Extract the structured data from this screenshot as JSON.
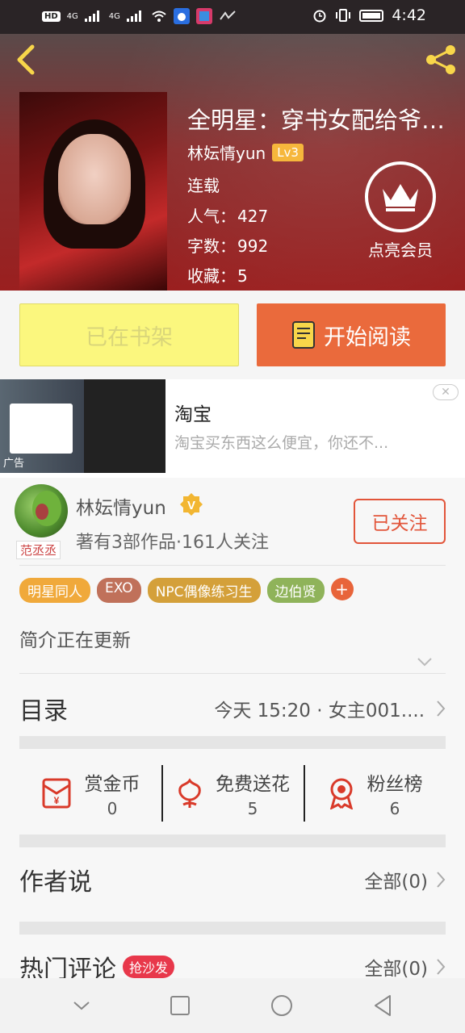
{
  "status_bar": {
    "hd": "HD",
    "net1": "4G",
    "net2": "4G",
    "time": "4:42"
  },
  "book": {
    "title": "全明星：穿书女配给爷…",
    "author": "林妘情yun",
    "level": "Lv3",
    "status": "连载",
    "popularity_label": "人气：",
    "popularity": "427",
    "words_label": "字数：",
    "words": "992",
    "favorites_label": "收藏：",
    "favorites": "5",
    "vip_label": "点亮会员"
  },
  "buttons": {
    "on_shelf": "已在书架",
    "start_reading": "开始阅读"
  },
  "ad": {
    "title": "淘宝",
    "description": "淘宝买东西这么便宜，你还不...",
    "tag": "广告",
    "close": "✕"
  },
  "author_card": {
    "name": "林妘情yun",
    "avatar_tag": "范丞丞",
    "stats": "著有3部作品·161人关注",
    "follow": "已关注"
  },
  "tags": [
    {
      "label": "明星同人",
      "color": "#f0a93b"
    },
    {
      "label": "EXO",
      "color": "#c0715a"
    },
    {
      "label": "NPC偶像练习生",
      "color": "#d4a03a"
    },
    {
      "label": "边伯贤",
      "color": "#8fb35a"
    }
  ],
  "intro": "简介正在更新",
  "toc": {
    "label": "目录",
    "latest": "今天 15:20 · 女主001...."
  },
  "stats": [
    {
      "label": "赏金币",
      "value": "0",
      "icon": "coin-envelope-icon"
    },
    {
      "label": "免费送花",
      "value": "5",
      "icon": "flower-icon"
    },
    {
      "label": "粉丝榜",
      "value": "6",
      "icon": "medal-icon"
    }
  ],
  "author_says": {
    "label": "作者说",
    "all": "全部(0)"
  },
  "hot_comments": {
    "label": "热门评论",
    "badge": "抢沙发",
    "all": "全部(0)"
  },
  "colors": {
    "accent": "#ea6a3c",
    "shelf": "#fbf77e",
    "follow": "#e2553a"
  }
}
